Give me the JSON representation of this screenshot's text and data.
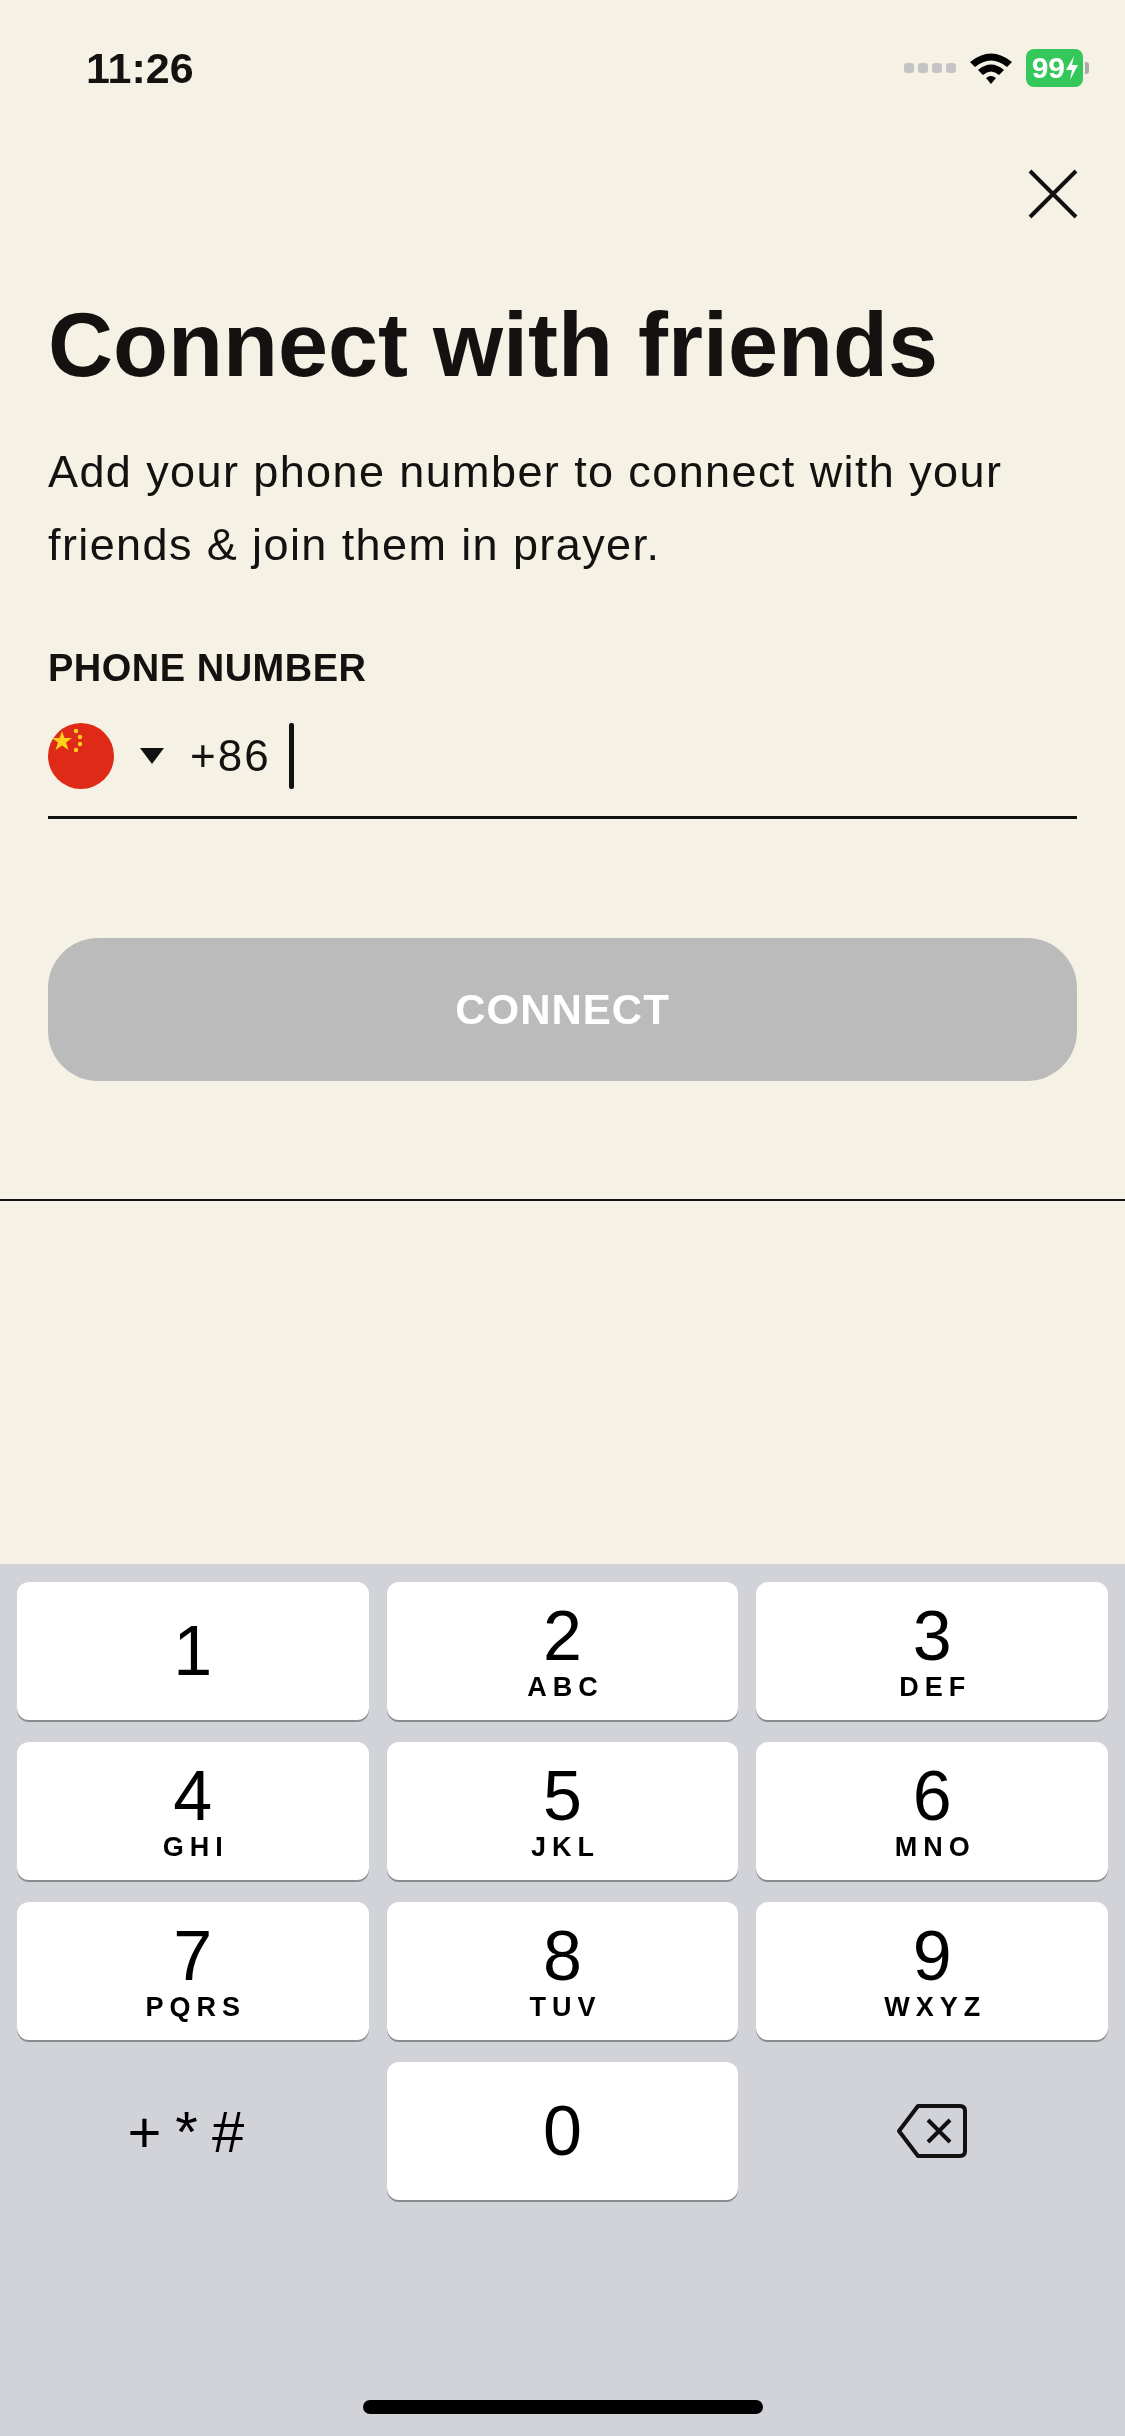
{
  "status_bar": {
    "time": "11:26",
    "battery": "99"
  },
  "title": "Connect with friends",
  "subtitle": "Add your phone number to connect with your friends & join them in prayer.",
  "phone_field": {
    "label": "PHONE NUMBER",
    "dial_code": "+86",
    "focused": true
  },
  "connect_button": {
    "label": "CONNECT",
    "disabled": true
  },
  "keypad": [
    {
      "kind": "digit",
      "digit": "1"
    },
    {
      "kind": "digit",
      "digit": "2",
      "letters": "ABC"
    },
    {
      "kind": "digit",
      "digit": "3",
      "letters": "DEF"
    },
    {
      "kind": "digit",
      "digit": "4",
      "letters": "GHI"
    },
    {
      "kind": "digit",
      "digit": "5",
      "letters": "JKL"
    },
    {
      "kind": "digit",
      "digit": "6",
      "letters": "MNO"
    },
    {
      "kind": "digit",
      "digit": "7",
      "letters": "PQRS"
    },
    {
      "kind": "digit",
      "digit": "8",
      "letters": "TUV"
    },
    {
      "kind": "digit",
      "digit": "9",
      "letters": "WXYZ"
    },
    {
      "kind": "symbols",
      "digit": "+*#"
    },
    {
      "kind": "digit",
      "digit": "0"
    },
    {
      "kind": "backspace"
    }
  ]
}
